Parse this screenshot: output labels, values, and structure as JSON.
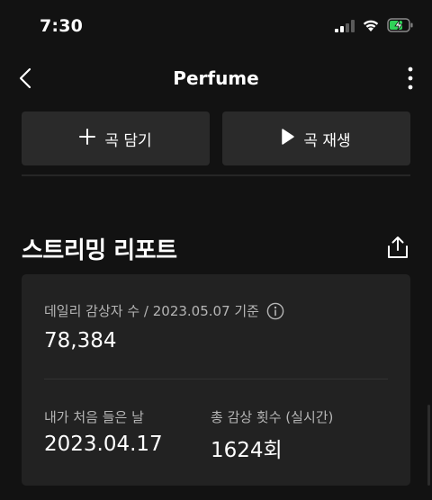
{
  "status_bar": {
    "time": "7:30",
    "icons": [
      "signal-icon",
      "wifi-icon",
      "battery-charging-icon"
    ]
  },
  "header": {
    "title": "Perfume",
    "back_icon": "chevron-left-icon",
    "more_icon": "more-vertical-icon"
  },
  "actions": {
    "add_label": "곡 담기",
    "play_label": "곡 재생"
  },
  "report": {
    "title": "스트리밍 리포트",
    "share_icon": "share-icon",
    "daily_label": "데일리 감상자 수 / 2023.05.07 기준",
    "daily_value": "78,384",
    "first_listen_label": "내가 처음 들은 날",
    "first_listen_value": "2023.04.17",
    "total_plays_label": "총 감상 횟수 (실시간)",
    "total_plays_value": "1624회"
  },
  "colors": {
    "background": "#121212",
    "button_bg": "#2a2a2a",
    "card_bg": "#222222",
    "battery_green": "#30d158",
    "secondary_text": "#b5b5b5"
  }
}
